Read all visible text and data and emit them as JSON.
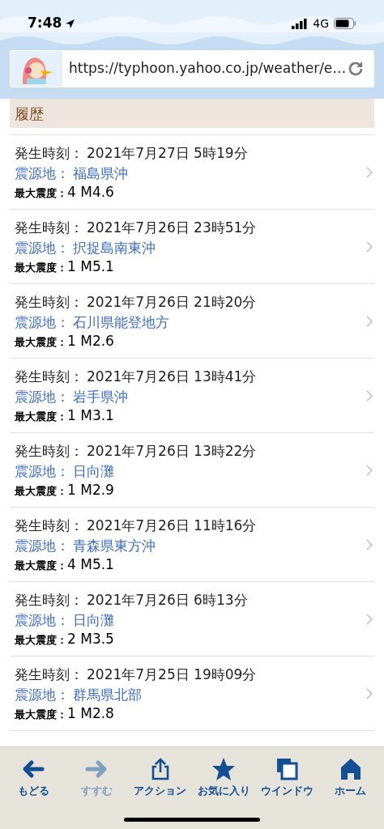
{
  "status_bar": {
    "time": "7:48",
    "network": "4G"
  },
  "browser": {
    "url": "https://typhoon.yahoo.co.jp/weather/e…"
  },
  "section": {
    "title": "履歴"
  },
  "quakes": [
    {
      "time_label": "発生時刻：",
      "time": "2021年7月27日 5時19分",
      "place_label": "震源地：",
      "place": "福島県沖",
      "intensity_label": "最大震度：",
      "intensity": "4 M4.6"
    },
    {
      "time_label": "発生時刻：",
      "time": "2021年7月26日 23時51分",
      "place_label": "震源地：",
      "place": "択捉島南東沖",
      "intensity_label": "最大震度：",
      "intensity": "1 M5.1"
    },
    {
      "time_label": "発生時刻：",
      "time": "2021年7月26日 21時20分",
      "place_label": "震源地：",
      "place": "石川県能登地方",
      "intensity_label": "最大震度：",
      "intensity": "1 M2.6"
    },
    {
      "time_label": "発生時刻：",
      "time": "2021年7月26日 13時41分",
      "place_label": "震源地：",
      "place": "岩手県沖",
      "intensity_label": "最大震度：",
      "intensity": "1 M3.1"
    },
    {
      "time_label": "発生時刻：",
      "time": "2021年7月26日 13時22分",
      "place_label": "震源地：",
      "place": "日向灘",
      "intensity_label": "最大震度：",
      "intensity": "1 M2.9"
    },
    {
      "time_label": "発生時刻：",
      "time": "2021年7月26日 11時16分",
      "place_label": "震源地：",
      "place": "青森県東方沖",
      "intensity_label": "最大震度：",
      "intensity": "4 M5.1"
    },
    {
      "time_label": "発生時刻：",
      "time": "2021年7月26日 6時13分",
      "place_label": "震源地：",
      "place": "日向灘",
      "intensity_label": "最大震度：",
      "intensity": "2 M3.5"
    },
    {
      "time_label": "発生時刻：",
      "time": "2021年7月25日 19時09分",
      "place_label": "震源地：",
      "place": "群馬県北部",
      "intensity_label": "最大震度：",
      "intensity": "1 M2.8"
    }
  ],
  "toolbar": [
    {
      "kind": "back",
      "label": "もどる",
      "disabled": false
    },
    {
      "kind": "forward",
      "label": "すすむ",
      "disabled": true
    },
    {
      "kind": "share",
      "label": "アクション",
      "disabled": false
    },
    {
      "kind": "star",
      "label": "お気に入り",
      "disabled": false
    },
    {
      "kind": "windows",
      "label": "ウインドウ",
      "disabled": false
    },
    {
      "kind": "home",
      "label": "ホーム",
      "disabled": false
    }
  ]
}
